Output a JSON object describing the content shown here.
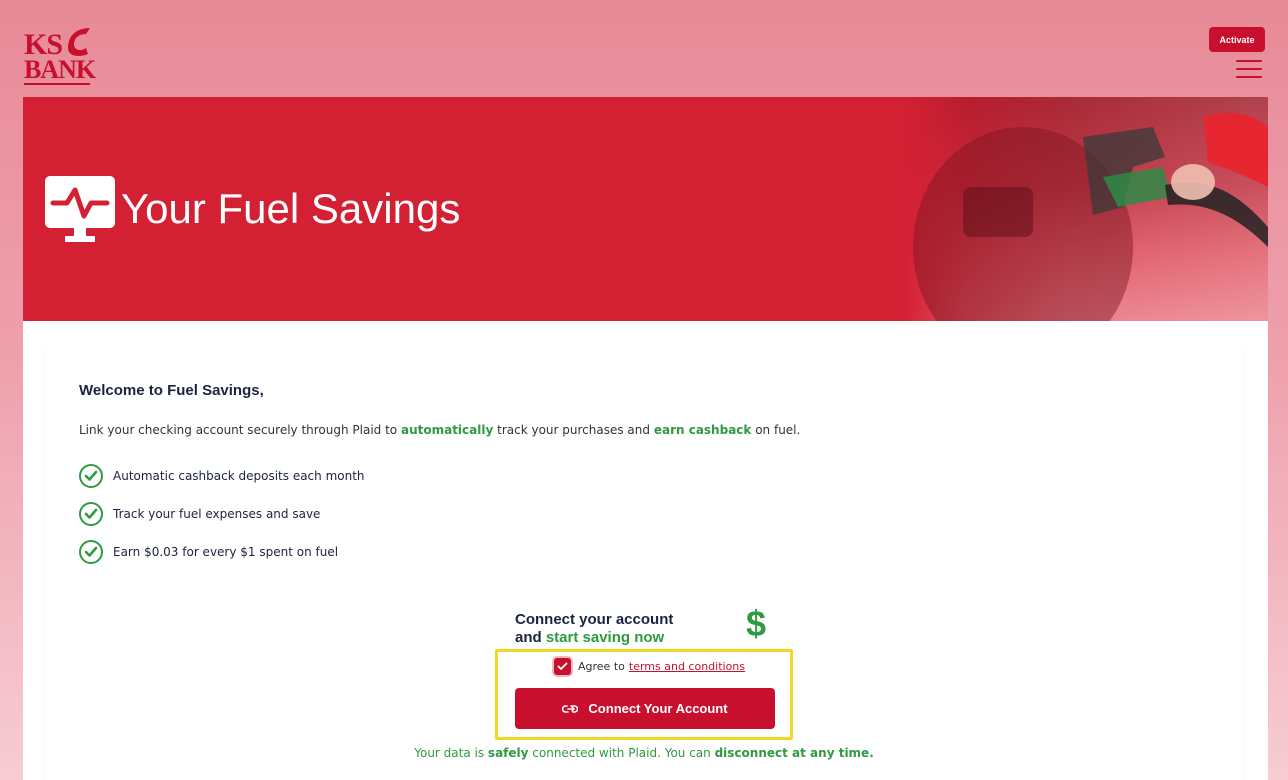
{
  "header": {
    "logo_top": "KS",
    "logo_bottom": "BANK",
    "activate_label": "Activate"
  },
  "hero": {
    "title": "Your Fuel Savings"
  },
  "content": {
    "welcome": "Welcome to Fuel Savings,",
    "intro": {
      "part1": "Link your checking account securely through Plaid to ",
      "bold1": "automatically",
      "part2": " track your purchases and ",
      "bold2": "earn cashback",
      "part3": " on fuel."
    },
    "benefits": [
      "Automatic cashback deposits each month",
      "Track your fuel expenses and save",
      "Earn $0.03 for every $1 spent on fuel"
    ],
    "cta": {
      "line1": "Connect your account",
      "line2_prefix": "and ",
      "line2_green": "start saving now",
      "dollar": "$"
    },
    "agree": {
      "prefix": "Agree to",
      "link": "terms and conditions",
      "checked": true
    },
    "connect_label": "Connect Your Account",
    "footer": {
      "p1": "Your data is ",
      "b1": "safely",
      "p2": " connected with Plaid. You can ",
      "b2": "disconnect at any time."
    }
  },
  "colors": {
    "brand_red": "#c8102e",
    "hero_red": "#d42033",
    "accent_green": "#2f9a41",
    "highlight_yellow": "#f2d624"
  }
}
